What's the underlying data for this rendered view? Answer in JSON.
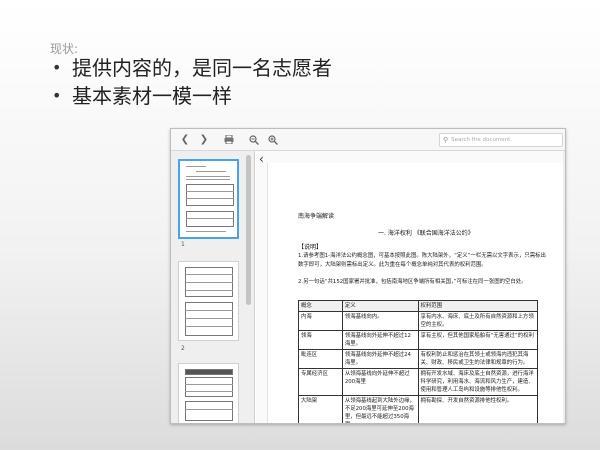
{
  "slide": {
    "label": "现状:",
    "bullets": [
      "提供内容的，是同一名志愿者",
      "基本素材一模一样"
    ]
  },
  "viewer": {
    "toolbar": {
      "back_icon": "chevron-left-icon",
      "forward_icon": "chevron-right-icon",
      "print_icon": "printer-icon",
      "zoom_out_icon": "zoom-out-icon",
      "zoom_in_icon": "zoom-in-icon",
      "search_placeholder": "Search the document."
    },
    "sidebar": {
      "thumbnails": [
        {
          "page": "1",
          "selected": true
        },
        {
          "page": "2",
          "selected": false
        },
        {
          "page": "",
          "selected": false
        }
      ]
    },
    "document": {
      "title": "南海争端解读",
      "subtitle": "一. 海洋权利 《联合国海洋法公约》",
      "section": "【说明】",
      "para1": "1.请参考图1-海洋法公约概念图，可基本按照此图。陈大陆架外，“定义”一栏无需以文字表示，只需标出数字即可，大陆架则需标出定义。此为重在每个概念单纯对其代表的权利范围。",
      "para2": "2.另一句话“共152国家署并批准，包括南海地区争端所有相关国，”可标注在同一张图的空白处。",
      "table": {
        "headers": [
          "概念",
          "定义",
          "权利范围"
        ],
        "rows": [
          [
            "内海",
            "领海基线向内。",
            "享有内水、海床、底土及所有自然资源和上方领空的主权。"
          ],
          [
            "领海",
            "领海基线向外延伸不超过12海里。",
            "享有主权，但其他国家船舶有“无害通过”的权利"
          ],
          [
            "毗连区",
            "领海基线向外延伸不超过24海里。",
            "有权利防止和惩治在其领土或领海内违犯其海关、财政、移民或卫生的法律和规章的行为。"
          ],
          [
            "专属经济区",
            "从领海基线向外延伸不超过200海里",
            "拥有开发水域、海床及底土自然资源，进行海洋科学研究，利用海水、海流和风力生产，建造、使用和管理人工岛屿和设施等排他性权利。"
          ],
          [
            "大陆架",
            "从领海基线起到大陆外边缘，不足200海里可延伸至200海里，但最远不能超过350海里。",
            "拥有勘探、开发自然资源排他性权利。"
          ]
        ]
      }
    }
  }
}
